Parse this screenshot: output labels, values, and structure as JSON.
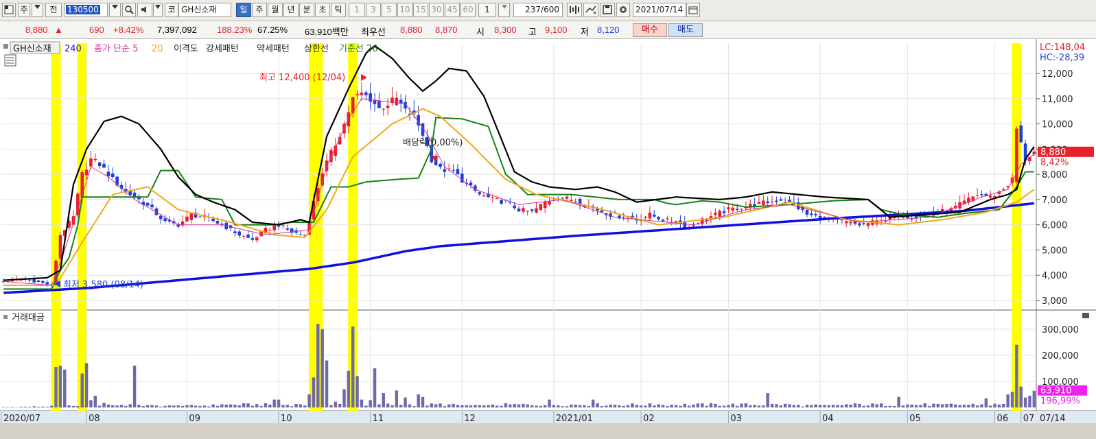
{
  "toolbar": {
    "b1": "주",
    "b2": "전",
    "code": "130500",
    "b3": "코",
    "name": "GH신소재",
    "periods": [
      "일",
      "주",
      "월",
      "년",
      "분",
      "초",
      "틱"
    ],
    "nums": [
      "1",
      "3",
      "5",
      "10",
      "15",
      "30",
      "45",
      "60"
    ],
    "count_sel": "1",
    "count": "237",
    "count_max": "/600",
    "date": "2021/07/14",
    "icons": [
      "search-icon",
      "speaker-icon",
      "chart-tools-icon",
      "compare-icon",
      "save-icon",
      "gear-icon",
      "calendar-icon"
    ]
  },
  "quote": {
    "price": "8,880",
    "arrow": "▲",
    "change": "690",
    "rate": "+8.42%",
    "volume": "7,397,092",
    "vol_ratio": "188.23%",
    "turnover": "67.25%",
    "amount": "63,910백만",
    "bid_label": "최우선",
    "ask": "8,880",
    "bid": "8,870",
    "open_label": "시",
    "open": "8,300",
    "high_label": "고",
    "high": "9,100",
    "low_label": "저",
    "low": "8,120",
    "buy": "매수",
    "sell": "매도"
  },
  "legend": {
    "stock": "GH신소재",
    "ma240": "240",
    "ma_label": "종가 단순 5",
    "ma20": "20",
    "disparity": "이격도",
    "strong": "강세패턴",
    "weak": "약세패턴",
    "limit": "상한선",
    "baseline": "기준선 26",
    "lc": "LC:148,04",
    "hc": "HC:-28,39",
    "vol_title": "거래대금"
  },
  "annotations": {
    "high": "최고 12,400 (12/04)",
    "low": "최저 3,580 (08/14)",
    "dividend": "배당락(0,00%)"
  },
  "last_price_box": {
    "value": "8,880",
    "pct": "8,42%"
  },
  "last_vol_box": {
    "value": "63,910",
    "pct": "196,99%"
  },
  "colors": {
    "up": "#e8202a",
    "down": "#1e40d8",
    "ma5": "#e0309a",
    "ma20": "#f0a81a",
    "ma240": "#1010e0",
    "baseline": "#188018",
    "disparity": "#000000",
    "highlight": "#ffff00",
    "volume": "#6e6aa8"
  },
  "chart_data": {
    "type": "candlestick",
    "price_axis": {
      "ticks": [
        "3,000",
        "4,000",
        "5,000",
        "6,000",
        "7,000",
        "8,000",
        "9,000",
        "10,000",
        "11,000",
        "12,000"
      ],
      "ylim": [
        2700,
        13200
      ]
    },
    "volume_axis": {
      "ticks": [
        "100,000",
        "200,000",
        "300,000"
      ],
      "ylim": [
        0,
        360000
      ]
    },
    "x_ticks": [
      "2020/07",
      "08",
      "09",
      "10",
      "11",
      "12",
      "2021/01",
      "02",
      "03",
      "04",
      "05",
      "06",
      "07"
    ],
    "x_end_label": "07/14",
    "total_bars": 237,
    "highlight_bars": [
      12,
      18,
      71,
      72,
      80,
      232
    ],
    "price_anchors": [
      [
        0,
        3750
      ],
      [
        5,
        3850
      ],
      [
        11,
        3600
      ],
      [
        13,
        5600
      ],
      [
        16,
        6300
      ],
      [
        18,
        8000
      ],
      [
        20,
        8600
      ],
      [
        22,
        8400
      ],
      [
        25,
        7800
      ],
      [
        28,
        7300
      ],
      [
        31,
        7000
      ],
      [
        34,
        6600
      ],
      [
        37,
        6100
      ],
      [
        40,
        6000
      ],
      [
        43,
        6400
      ],
      [
        46,
        6300
      ],
      [
        50,
        6000
      ],
      [
        54,
        5600
      ],
      [
        57,
        5400
      ],
      [
        60,
        5800
      ],
      [
        63,
        6000
      ],
      [
        66,
        5700
      ],
      [
        69,
        5600
      ],
      [
        71,
        6900
      ],
      [
        73,
        8100
      ],
      [
        76,
        9200
      ],
      [
        78,
        10000
      ],
      [
        80,
        11000
      ],
      [
        82,
        11200
      ],
      [
        84,
        11000
      ],
      [
        86,
        10600
      ],
      [
        88,
        10800
      ],
      [
        90,
        11000
      ],
      [
        92,
        10500
      ],
      [
        94,
        10300
      ],
      [
        96,
        9600
      ],
      [
        98,
        8600
      ],
      [
        100,
        8200
      ],
      [
        103,
        8100
      ],
      [
        106,
        7600
      ],
      [
        109,
        7200
      ],
      [
        112,
        7000
      ],
      [
        115,
        6900
      ],
      [
        118,
        6600
      ],
      [
        121,
        6500
      ],
      [
        124,
        6900
      ],
      [
        127,
        7100
      ],
      [
        130,
        7000
      ],
      [
        133,
        6800
      ],
      [
        136,
        6600
      ],
      [
        139,
        6400
      ],
      [
        142,
        6300
      ],
      [
        145,
        6200
      ],
      [
        148,
        6400
      ],
      [
        151,
        6200
      ],
      [
        154,
        6100
      ],
      [
        157,
        5900
      ],
      [
        160,
        6200
      ],
      [
        163,
        6400
      ],
      [
        166,
        6600
      ],
      [
        169,
        6700
      ],
      [
        172,
        6800
      ],
      [
        175,
        6900
      ],
      [
        178,
        7000
      ],
      [
        181,
        6800
      ],
      [
        184,
        6400
      ],
      [
        187,
        6300
      ],
      [
        190,
        6200
      ],
      [
        193,
        6100
      ],
      [
        196,
        6000
      ],
      [
        199,
        6100
      ],
      [
        202,
        6200
      ],
      [
        205,
        6400
      ],
      [
        208,
        6300
      ],
      [
        211,
        6400
      ],
      [
        214,
        6500
      ],
      [
        217,
        6600
      ],
      [
        220,
        6900
      ],
      [
        223,
        7200
      ],
      [
        226,
        7100
      ],
      [
        229,
        7400
      ],
      [
        231,
        7800
      ],
      [
        232,
        9800
      ],
      [
        234,
        8600
      ],
      [
        236,
        8880
      ]
    ],
    "ma5_anchors": [
      [
        0,
        3750
      ],
      [
        11,
        3600
      ],
      [
        14,
        5000
      ],
      [
        17,
        6600
      ],
      [
        20,
        8300
      ],
      [
        24,
        7900
      ],
      [
        30,
        7000
      ],
      [
        40,
        6000
      ],
      [
        50,
        6000
      ],
      [
        60,
        5600
      ],
      [
        70,
        5800
      ],
      [
        74,
        8300
      ],
      [
        79,
        10200
      ],
      [
        82,
        11000
      ],
      [
        92,
        10800
      ],
      [
        97,
        9600
      ],
      [
        101,
        8300
      ],
      [
        108,
        7400
      ],
      [
        118,
        6800
      ],
      [
        128,
        7000
      ],
      [
        140,
        6300
      ],
      [
        158,
        6000
      ],
      [
        170,
        6600
      ],
      [
        180,
        6800
      ],
      [
        196,
        6100
      ],
      [
        212,
        6300
      ],
      [
        224,
        7100
      ],
      [
        230,
        7400
      ],
      [
        233,
        8400
      ],
      [
        236,
        8800
      ]
    ],
    "ma20_anchors": [
      [
        0,
        3600
      ],
      [
        12,
        3600
      ],
      [
        18,
        5300
      ],
      [
        25,
        7200
      ],
      [
        33,
        7500
      ],
      [
        40,
        6600
      ],
      [
        52,
        6100
      ],
      [
        62,
        5600
      ],
      [
        69,
        5500
      ],
      [
        74,
        6600
      ],
      [
        80,
        8700
      ],
      [
        89,
        10000
      ],
      [
        96,
        10600
      ],
      [
        100,
        10300
      ],
      [
        107,
        9200
      ],
      [
        115,
        7800
      ],
      [
        122,
        7200
      ],
      [
        135,
        6700
      ],
      [
        150,
        6000
      ],
      [
        165,
        6300
      ],
      [
        180,
        6900
      ],
      [
        193,
        6200
      ],
      [
        205,
        6000
      ],
      [
        215,
        6200
      ],
      [
        225,
        6500
      ],
      [
        232,
        6900
      ],
      [
        236,
        7400
      ]
    ],
    "ma240_anchors": [
      [
        0,
        3300
      ],
      [
        20,
        3500
      ],
      [
        50,
        3950
      ],
      [
        70,
        4250
      ],
      [
        80,
        4500
      ],
      [
        92,
        4950
      ],
      [
        100,
        5150
      ],
      [
        130,
        5550
      ],
      [
        160,
        5900
      ],
      [
        190,
        6250
      ],
      [
        220,
        6550
      ],
      [
        236,
        6850
      ]
    ],
    "baseline_anchors": [
      [
        0,
        3450
      ],
      [
        11,
        3450
      ],
      [
        13,
        4200
      ],
      [
        15,
        4700
      ],
      [
        17,
        6000
      ],
      [
        18,
        7100
      ],
      [
        30,
        7100
      ],
      [
        33,
        7100
      ],
      [
        36,
        8150
      ],
      [
        40,
        8150
      ],
      [
        44,
        7100
      ],
      [
        50,
        7000
      ],
      [
        53,
        6000
      ],
      [
        62,
        6000
      ],
      [
        66,
        6100
      ],
      [
        71,
        6100
      ],
      [
        75,
        7500
      ],
      [
        79,
        7500
      ],
      [
        83,
        7700
      ],
      [
        90,
        7800
      ],
      [
        95,
        7850
      ],
      [
        98,
        9000
      ],
      [
        99,
        10250
      ],
      [
        105,
        10200
      ],
      [
        111,
        9900
      ],
      [
        115,
        8000
      ],
      [
        117,
        7700
      ],
      [
        120,
        7200
      ],
      [
        130,
        7200
      ],
      [
        141,
        7000
      ],
      [
        149,
        7000
      ],
      [
        152,
        6850
      ],
      [
        154,
        6800
      ],
      [
        160,
        6950
      ],
      [
        164,
        6900
      ],
      [
        170,
        6700
      ],
      [
        180,
        6800
      ],
      [
        190,
        6950
      ],
      [
        198,
        7000
      ],
      [
        201,
        6600
      ],
      [
        206,
        6400
      ],
      [
        214,
        6300
      ],
      [
        220,
        6450
      ],
      [
        228,
        6600
      ],
      [
        232,
        7500
      ],
      [
        234,
        8100
      ],
      [
        236,
        8100
      ]
    ],
    "disparity_anchors": [
      [
        0,
        3800
      ],
      [
        10,
        3900
      ],
      [
        13,
        4200
      ],
      [
        16,
        7600
      ],
      [
        19,
        9000
      ],
      [
        23,
        10100
      ],
      [
        27,
        10300
      ],
      [
        31,
        10000
      ],
      [
        36,
        9000
      ],
      [
        40,
        7900
      ],
      [
        44,
        7200
      ],
      [
        48,
        6900
      ],
      [
        53,
        6600
      ],
      [
        57,
        6100
      ],
      [
        63,
        6000
      ],
      [
        68,
        6200
      ],
      [
        70,
        6100
      ],
      [
        74,
        9500
      ],
      [
        79,
        11400
      ],
      [
        83,
        12800
      ],
      [
        85,
        13100
      ],
      [
        89,
        12600
      ],
      [
        93,
        11800
      ],
      [
        96,
        11300
      ],
      [
        99,
        11700
      ],
      [
        102,
        12200
      ],
      [
        106,
        12100
      ],
      [
        110,
        11100
      ],
      [
        114,
        9400
      ],
      [
        117,
        8100
      ],
      [
        121,
        7700
      ],
      [
        125,
        7500
      ],
      [
        131,
        7400
      ],
      [
        136,
        7500
      ],
      [
        140,
        7300
      ],
      [
        145,
        6900
      ],
      [
        154,
        7100
      ],
      [
        164,
        7000
      ],
      [
        170,
        7100
      ],
      [
        176,
        7300
      ],
      [
        182,
        7200
      ],
      [
        188,
        7100
      ],
      [
        198,
        7000
      ],
      [
        203,
        6300
      ],
      [
        211,
        6400
      ],
      [
        219,
        6500
      ],
      [
        226,
        7000
      ],
      [
        230,
        7200
      ],
      [
        232,
        7400
      ],
      [
        234,
        8600
      ],
      [
        236,
        9100
      ]
    ],
    "volume_anchors": [
      [
        0,
        2000
      ],
      [
        11,
        6000
      ],
      [
        12,
        155000
      ],
      [
        13,
        160000
      ],
      [
        14,
        145000
      ],
      [
        15,
        8000
      ],
      [
        17,
        5000
      ],
      [
        18,
        130000
      ],
      [
        19,
        170000
      ],
      [
        20,
        28000
      ],
      [
        21,
        45000
      ],
      [
        23,
        18000
      ],
      [
        27,
        10000
      ],
      [
        30,
        160000
      ],
      [
        31,
        10000
      ],
      [
        40,
        8000
      ],
      [
        50,
        12000
      ],
      [
        62,
        30000
      ],
      [
        63,
        30000
      ],
      [
        68,
        12000
      ],
      [
        70,
        50000
      ],
      [
        71,
        115000
      ],
      [
        72,
        320000
      ],
      [
        73,
        300000
      ],
      [
        74,
        180000
      ],
      [
        76,
        22000
      ],
      [
        78,
        70000
      ],
      [
        79,
        140000
      ],
      [
        80,
        310000
      ],
      [
        81,
        120000
      ],
      [
        82,
        30000
      ],
      [
        84,
        28000
      ],
      [
        85,
        150000
      ],
      [
        87,
        55000
      ],
      [
        90,
        65000
      ],
      [
        92,
        38000
      ],
      [
        95,
        50000
      ],
      [
        96,
        40000
      ],
      [
        100,
        15000
      ],
      [
        110,
        8000
      ],
      [
        125,
        30000
      ],
      [
        135,
        30000
      ],
      [
        150,
        12000
      ],
      [
        175,
        55000
      ],
      [
        180,
        12000
      ],
      [
        190,
        10000
      ],
      [
        205,
        40000
      ],
      [
        215,
        12000
      ],
      [
        225,
        35000
      ],
      [
        230,
        50000
      ],
      [
        231,
        60000
      ],
      [
        232,
        240000
      ],
      [
        233,
        80000
      ],
      [
        234,
        38000
      ],
      [
        235,
        45000
      ],
      [
        236,
        63910
      ]
    ],
    "series": [
      {
        "name": "종가 단순 5"
      },
      {
        "name": "20"
      },
      {
        "name": "240"
      },
      {
        "name": "기준선 26"
      },
      {
        "name": "이격도"
      }
    ]
  }
}
